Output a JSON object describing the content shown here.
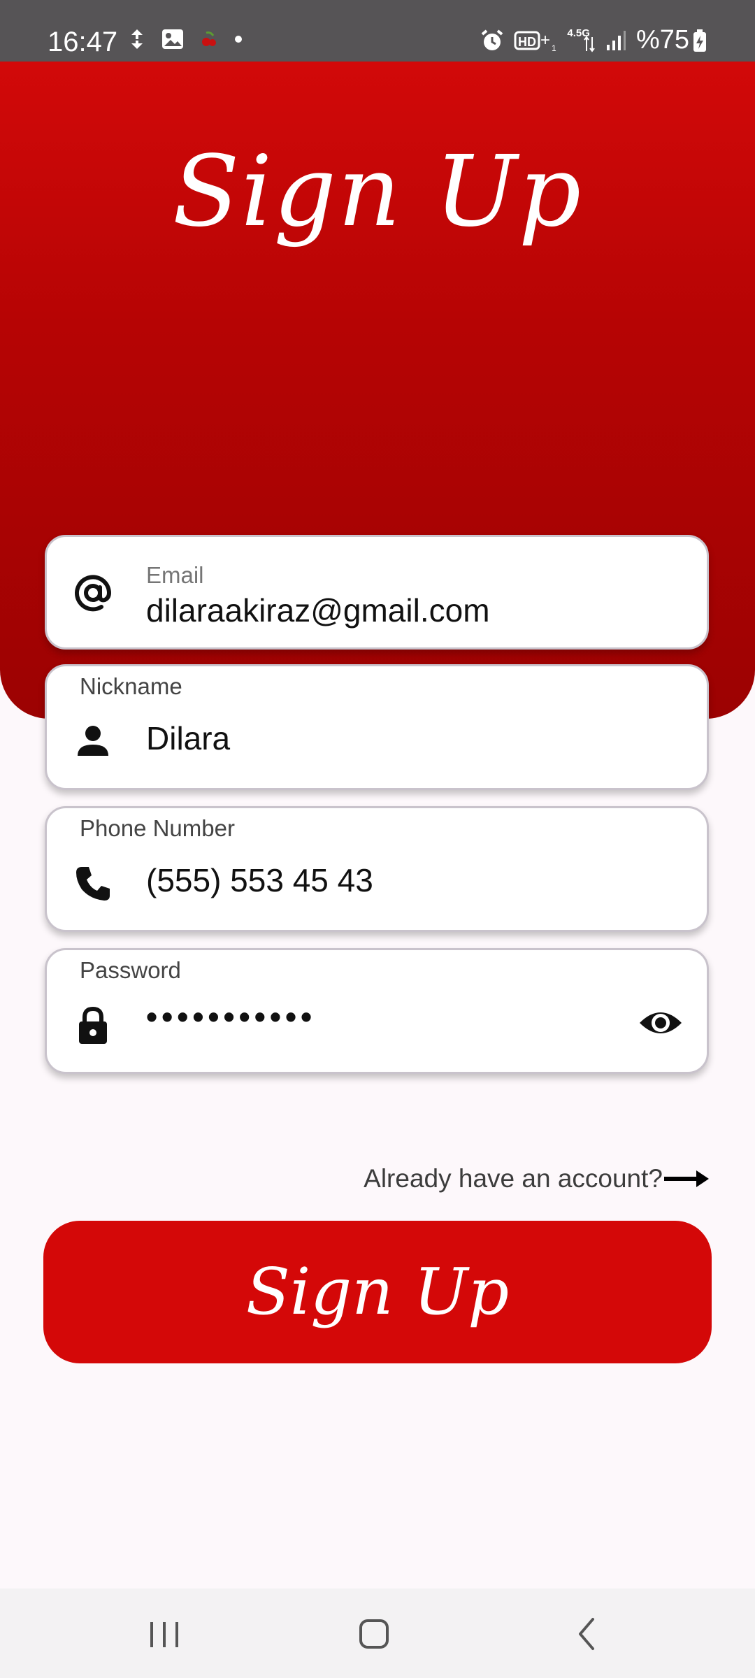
{
  "status_bar": {
    "time": "16:47",
    "battery": "%75",
    "network_label": "4.5G",
    "left_icons": [
      "sync-icon",
      "image-icon",
      "cherry-app-icon",
      "dot-icon"
    ],
    "right_icons": [
      "alarm-icon",
      "hd-plus-icon",
      "data-arrows-icon",
      "signal-icon",
      "battery-charging-icon"
    ]
  },
  "header": {
    "title": "Sign Up"
  },
  "form": {
    "email": {
      "label": "Email",
      "value": "dilaraakiraz@gmail.com",
      "icon": "at-icon"
    },
    "nickname": {
      "label": "Nickname",
      "value": "Dilara",
      "icon": "person-icon"
    },
    "phone": {
      "label": "Phone Number",
      "value": "(555) 553 45 43",
      "icon": "phone-icon"
    },
    "password": {
      "label": "Password",
      "value": "•••••••••••",
      "icon": "lock-icon",
      "toggle_icon": "eye-icon"
    }
  },
  "login_link": {
    "text": "Already have an account?",
    "icon": "arrow-right-icon"
  },
  "signup_button": {
    "label": "Sign Up"
  },
  "nav_bar": {
    "items": [
      "recent-apps-icon",
      "home-icon",
      "back-icon"
    ]
  },
  "colors": {
    "accent": "#d40808",
    "header_top": "#d20909",
    "header_bottom": "#9c0202",
    "background": "#fdf8fb",
    "status_bar": "#565456"
  }
}
